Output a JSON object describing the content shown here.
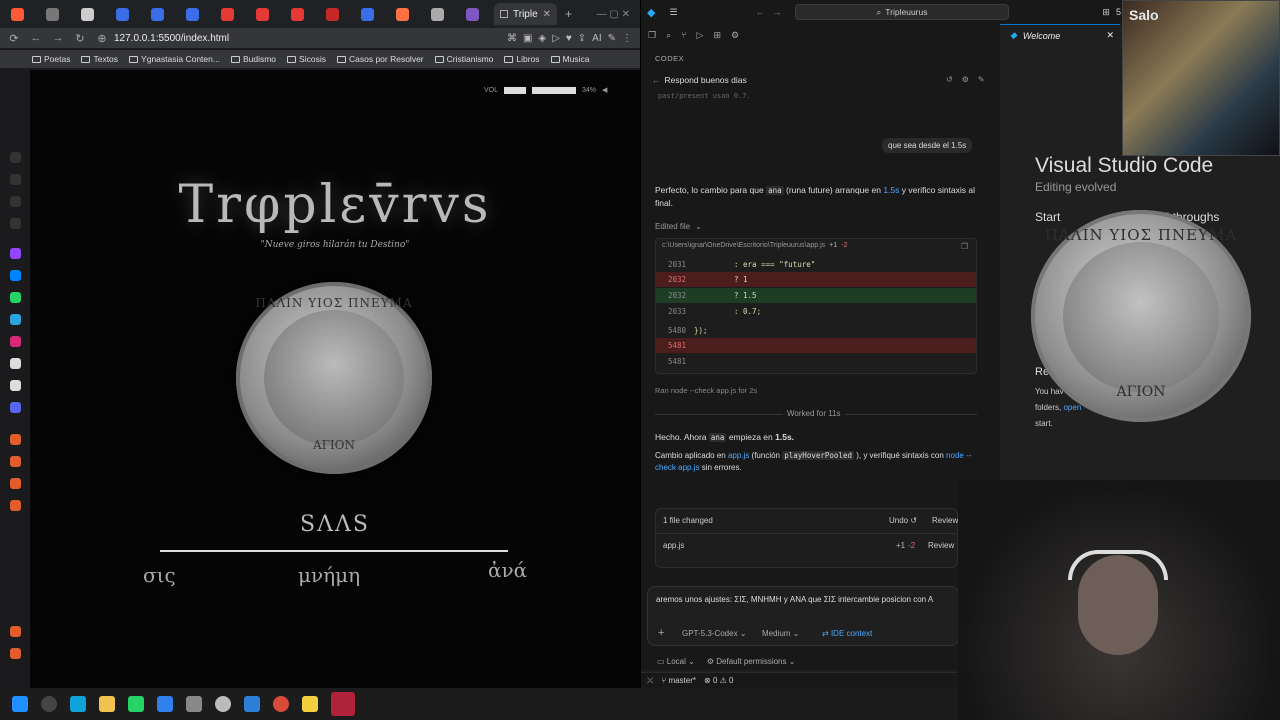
{
  "browser": {
    "active_tab_title": "Triple",
    "url": "127.0.0.1:5500/index.html",
    "ai_label": "AI",
    "bookmarks": [
      "Poetas",
      "Textos",
      "Ygnastasia Conten...",
      "Budismo",
      "Sicosis",
      "Casos por Resolver",
      "Cristianismo",
      "Libros",
      "Musica"
    ]
  },
  "site": {
    "title": "Trφplεv̄rvs",
    "subtitle": "\"Nueve giros hilarán tu Destino\"",
    "coin_top": "ΠΑΛΙΝ ΥΙΟΣ ΠΝΕΥΜΑ",
    "coin_bottom": "ΑΓΙΟΝ",
    "saas": "SΛΛS",
    "word_left": "σις",
    "word_center": "μνήμη",
    "word_right": "ἀνά",
    "vol_label": "VOL",
    "vol_percent": "34%",
    "vol_level": 0.34
  },
  "vscode": {
    "search": "Tripleuurus",
    "badge_count": "5",
    "panel_label": "CODEX",
    "thread_title": "Respond buenos dias",
    "prev_line": "past/present usan 0.7.",
    "user_message": "que sea desde el 1.5s",
    "assistant_1": "Perfecto, lo cambio para que",
    "assistant_1_code": "ana",
    "assistant_1_b": "(runa future) arranque en",
    "assistant_1_link": "1.5s",
    "assistant_1_c": "y verifico sintaxis al final.",
    "edited_label": "Edited file",
    "diff_path": "c:\\Users\\ignar\\OneDrive\\Escritorio\\Tripleuurus\\app.js",
    "diff_plus": "+1",
    "diff_minus": "-2",
    "diff_lines": [
      {
        "n": "2031",
        "t": ": era === \"future\"",
        "k": "ctx"
      },
      {
        "n": "2032",
        "t": "? 1",
        "k": "del"
      },
      {
        "n": "2032",
        "t": "? 1.5",
        "k": "add"
      },
      {
        "n": "2033",
        "t": ": 0.7;",
        "k": "ctx"
      },
      {
        "n": "5480",
        "t": "});",
        "k": "ctx"
      },
      {
        "n": "5481",
        "t": "",
        "k": "del"
      },
      {
        "n": "5481",
        "t": "",
        "k": "ctx"
      }
    ],
    "ran_label": "Ran",
    "ran_cmd": "node --check app.js for 2s",
    "worked": "Worked for 11s",
    "done_a": "Hecho. Ahora",
    "done_code": "ana",
    "done_b": "empieza en",
    "done_bold": "1.5s.",
    "applied_a": "Cambio aplicado en",
    "applied_link": "app.js",
    "applied_b": "(función",
    "applied_code": "playHoverPooled",
    "applied_c": "), y verifiqué sintaxis con",
    "applied_link2": "node --check app.js",
    "applied_d": "sin errores.",
    "files_changed": "1 file changed",
    "undo": "Undo",
    "review": "Review",
    "file_name": "app.js",
    "file_plus": "+1",
    "file_minus": "-2",
    "composer_text": "aremos unos ajustes: ΣΙΣ, ΜΝΗΜΗ y ΑΝΑ que ΣΙΣ intercambie posicion con A",
    "model": "GPT-5.3-Codex",
    "effort": "Medium",
    "ide_context": "IDE context",
    "local": "Local",
    "permissions": "Default permissions",
    "branch": "master*",
    "errors": "0",
    "warnings": "0"
  },
  "welcome": {
    "tab": "Welcome",
    "title": "Visual Studio Code",
    "subtitle": "Editing evolved",
    "start": "Start",
    "walkthroughs": "lkthroughs",
    "recent_fragment": "Re",
    "you_have": "You hav",
    "folders": "folders,",
    "open": "open",
    "start_word": "start.",
    "coin_top": "ΠΑΛΙΝ ΥΙΟΣ ΠΝΕΥΜΑ",
    "coin_bottom": "ΑΓΙΟΝ"
  },
  "overlay": {
    "thumb_label": "Salo"
  },
  "colors": {
    "accent": "#0078d4",
    "link": "#4aa8ff",
    "diff_del": "#4b1d1d",
    "diff_add": "#1e3d25"
  }
}
